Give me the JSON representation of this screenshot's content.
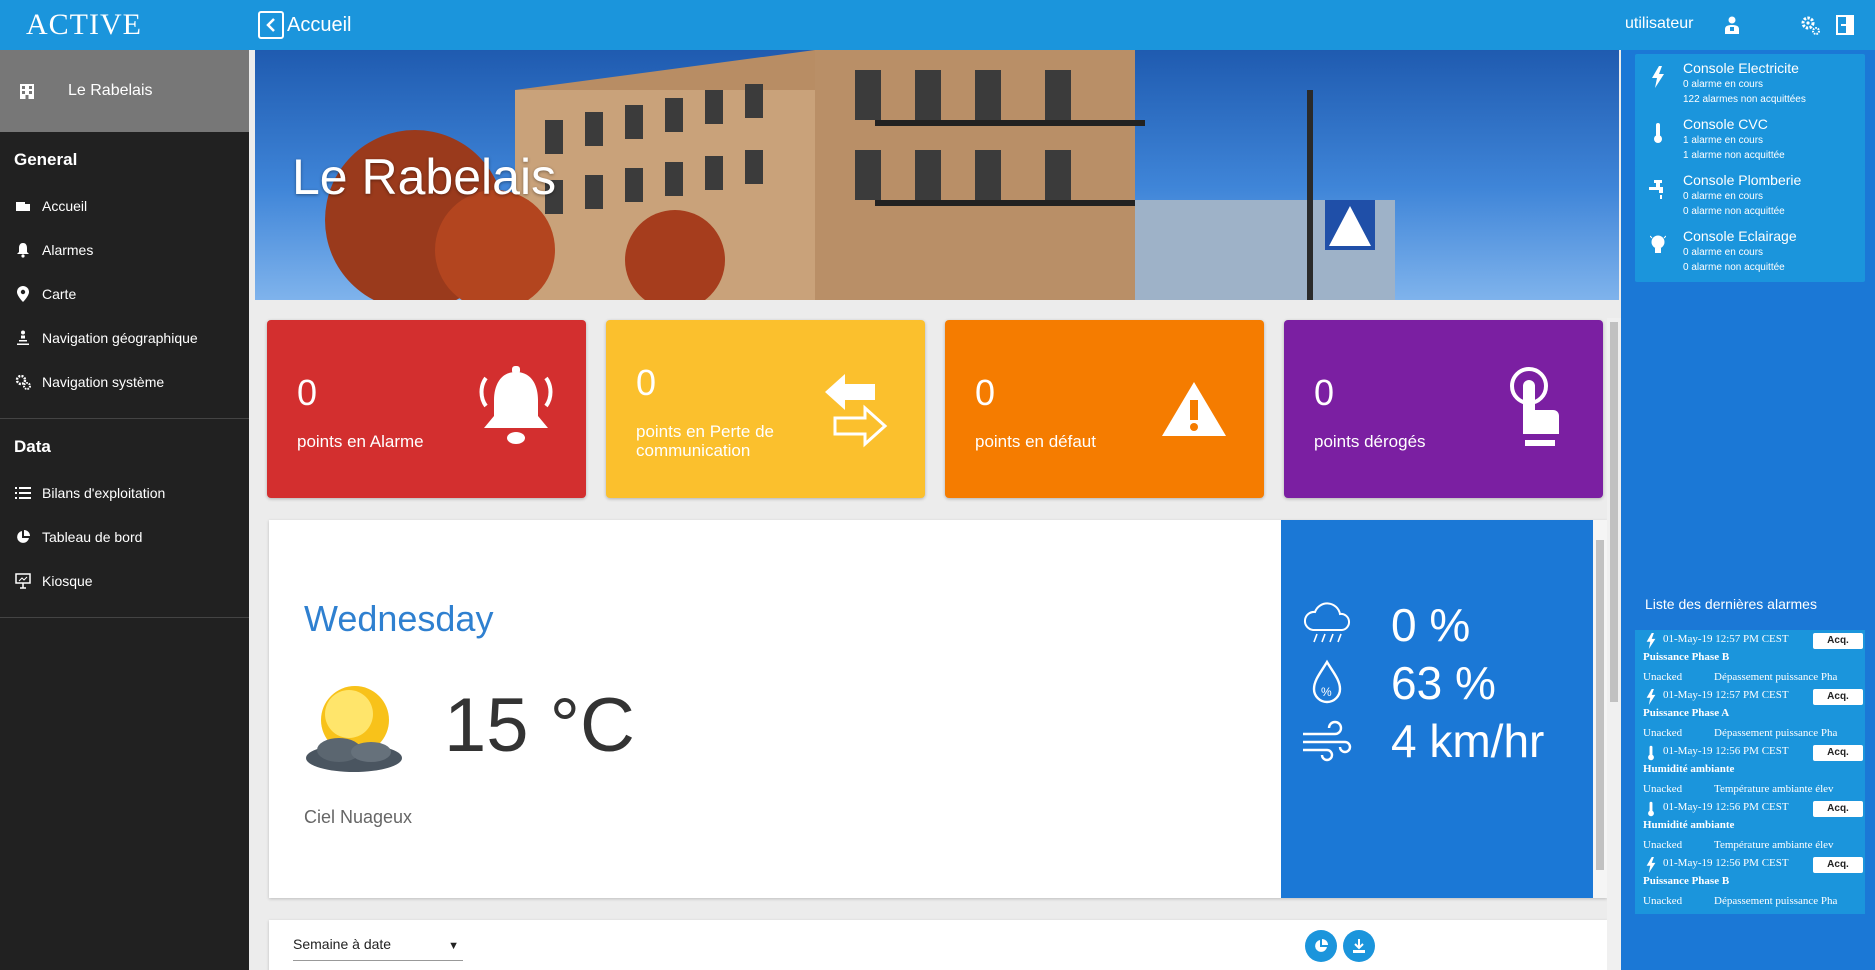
{
  "brand": "ACTIVE",
  "site": "Le Rabelais",
  "topbar": {
    "title": "Accueil",
    "user": "utilisateur"
  },
  "sidebar": {
    "general_title": "General",
    "general": [
      {
        "label": "Accueil",
        "icon": "home-icon"
      },
      {
        "label": "Alarmes",
        "icon": "bell-icon"
      },
      {
        "label": "Carte",
        "icon": "map-pin-icon"
      },
      {
        "label": "Navigation géographique",
        "icon": "geo-nav-icon"
      },
      {
        "label": "Navigation système",
        "icon": "system-nav-icon"
      }
    ],
    "data_title": "Data",
    "data": [
      {
        "label": "Bilans d'exploitation",
        "icon": "list-icon"
      },
      {
        "label": "Tableau de bord",
        "icon": "pie-icon"
      },
      {
        "label": "Kiosque",
        "icon": "kiosk-icon"
      }
    ]
  },
  "hero": {
    "title": "Le Rabelais"
  },
  "tiles": [
    {
      "value": "0",
      "label": "points en Alarme",
      "color": "#d32f2f",
      "icon": "bell-ringing-icon"
    },
    {
      "value": "0",
      "label": "points en Perte de communication",
      "color": "#fbc02d",
      "icon": "exchange-arrows-icon"
    },
    {
      "value": "0",
      "label": "points en défaut",
      "color": "#f57c00",
      "icon": "warning-icon"
    },
    {
      "value": "0",
      "label": "points dérogés",
      "color": "#7b1fa2",
      "icon": "hand-pointer-icon"
    }
  ],
  "weather": {
    "day": "Wednesday",
    "temp": "15 °C",
    "desc": "Ciel Nuageux",
    "precip": "0 %",
    "humidity": "63 %",
    "wind": "4 km/hr"
  },
  "bottom": {
    "period": "Semaine à date"
  },
  "consoles": [
    {
      "title": "Console Electricite",
      "active": "0 alarme en cours",
      "unack": "122 alarmes non acquittées",
      "icon": "lightning-icon"
    },
    {
      "title": "Console CVC",
      "active": "1 alarme en cours",
      "unack": "1 alarme non acquittée",
      "icon": "thermometer-icon"
    },
    {
      "title": "Console Plomberie",
      "active": "0 alarme en cours",
      "unack": "0 alarme non acquittée",
      "icon": "faucet-icon"
    },
    {
      "title": "Console Eclairage",
      "active": "0 alarme en cours",
      "unack": "0 alarme non acquittée",
      "icon": "bulb-icon"
    }
  ],
  "alarms_title": "Liste des dernières alarmes",
  "alarms": [
    {
      "date": "01-May-19 12:57 PM CEST",
      "name": "Puissance Phase B",
      "state": "Unacked",
      "desc": "Dépassement puissance Pha",
      "ack": "Acq.",
      "icon": "lightning-icon"
    },
    {
      "date": "01-May-19 12:57 PM CEST",
      "name": "Puissance Phase A",
      "state": "Unacked",
      "desc": "Dépassement puissance Pha",
      "ack": "Acq.",
      "icon": "lightning-icon"
    },
    {
      "date": "01-May-19 12:56 PM CEST",
      "name": "Humidité ambiante",
      "state": "Unacked",
      "desc": "Température ambiante élev",
      "ack": "Acq.",
      "icon": "thermometer-icon"
    },
    {
      "date": "01-May-19 12:56 PM CEST",
      "name": "Humidité ambiante",
      "state": "Unacked",
      "desc": "Température ambiante élev",
      "ack": "Acq.",
      "icon": "thermometer-icon"
    },
    {
      "date": "01-May-19 12:56 PM CEST",
      "name": "Puissance Phase B",
      "state": "Unacked",
      "desc": "Dépassement puissance Pha",
      "ack": "Acq.",
      "icon": "lightning-icon"
    }
  ]
}
